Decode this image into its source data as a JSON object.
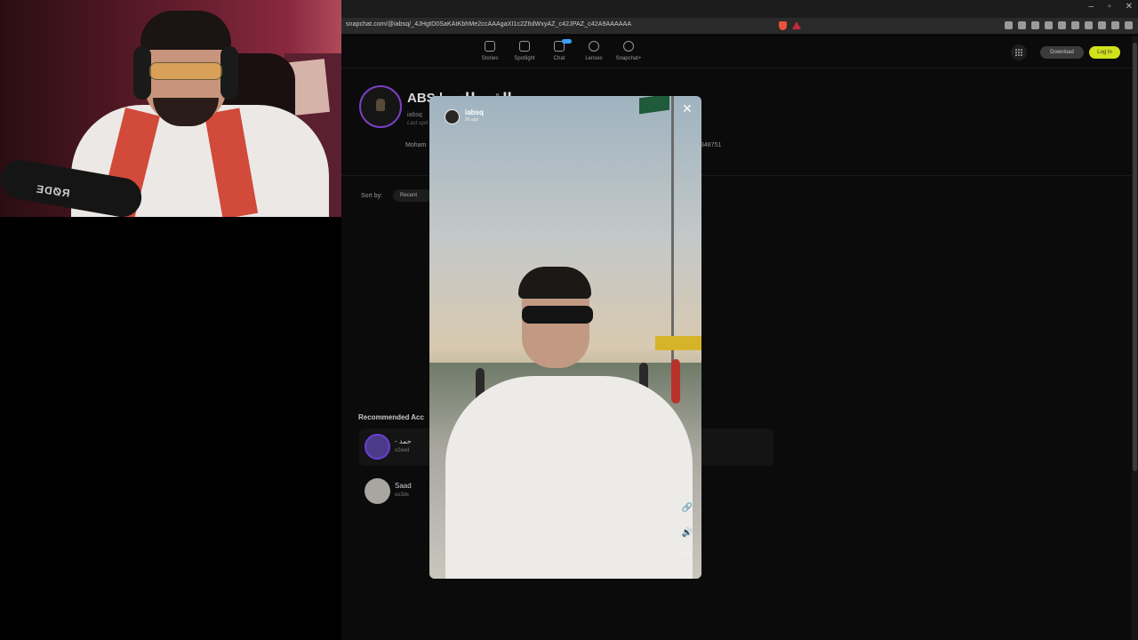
{
  "browser": {
    "url": "snapchat.com/@iabsq/_4JHgtD0SaKAtKbhMe2ccAAAgaXI1c2Z6dWxyAZ_c42JPAZ_c42A9AAAAAA",
    "window_controls": [
      "–",
      "▫",
      "✕"
    ]
  },
  "snapchat": {
    "nav": [
      {
        "label": "Stories",
        "icon": "stories-icon"
      },
      {
        "label": "Spotlight",
        "icon": "spotlight-icon"
      },
      {
        "label": "Chat",
        "icon": "chat-icon"
      },
      {
        "label": "Lenses",
        "icon": "lenses-icon"
      },
      {
        "label": "Snapchat+",
        "icon": "snapchat-plus-icon"
      }
    ],
    "download_label": "Download",
    "login_label": "Log In",
    "accent_color": "#cfe21a"
  },
  "profile": {
    "name": "ABS | محمد القحطاني",
    "username": "iabsq",
    "updated": "Last upd",
    "bio_start": "Moham",
    "bio_end": "348751"
  },
  "sort": {
    "label": "Sort by:",
    "value": "Recent"
  },
  "recommended": {
    "title": "Recommended Acc",
    "items": [
      {
        "name": "- حمد",
        "user": "x2eed"
      },
      {
        "name": "Saad",
        "user": "os3dx"
      }
    ]
  },
  "story": {
    "username": "iabsq",
    "time": "9h ago",
    "close_glyph": "✕",
    "link_glyph": "🔗",
    "sound_glyph": "🔊",
    "more_glyph": "⋯"
  },
  "webcam": {
    "mic_brand": "RØDE"
  }
}
